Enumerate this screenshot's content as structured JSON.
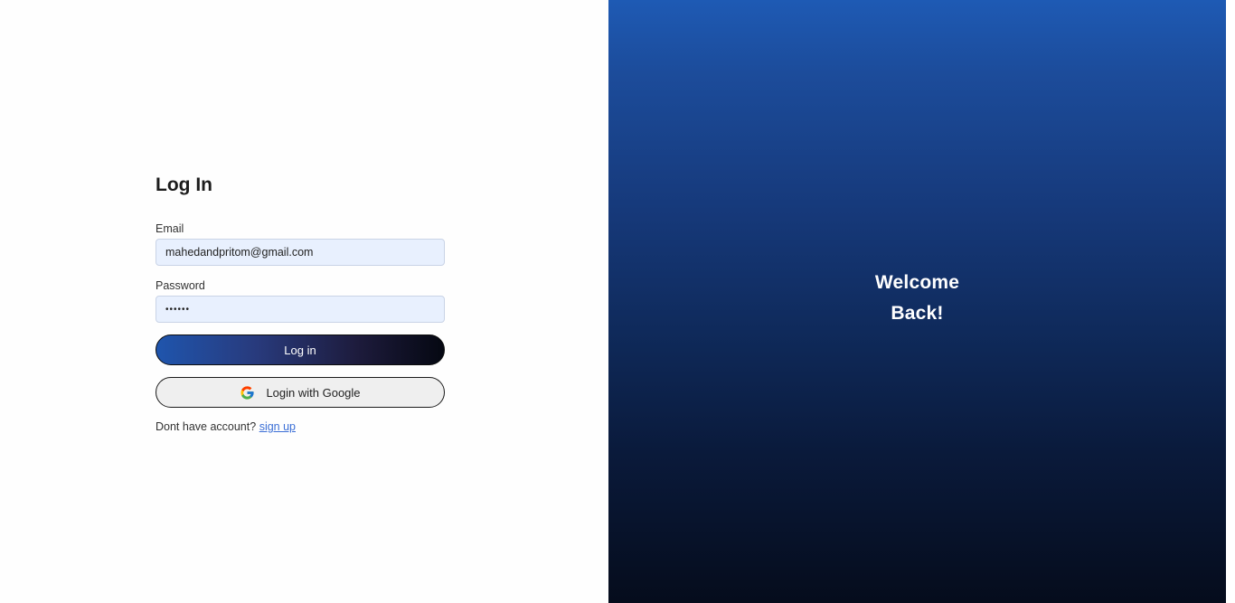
{
  "login": {
    "title": "Log In",
    "email_label": "Email",
    "email_value": "mahedandpritom@gmail.com",
    "password_label": "Password",
    "password_value": "••••••",
    "login_button": "Log in",
    "google_button": "Login with Google",
    "signup_prompt": "Dont have account?",
    "signup_link": "sign up"
  },
  "welcome": {
    "line1": "Welcome",
    "line2": "Back!"
  },
  "colors": {
    "accent": "#1e5ab4",
    "dark": "#050c1c",
    "link": "#3b6fd6",
    "input_bg": "#e8f0fe"
  }
}
